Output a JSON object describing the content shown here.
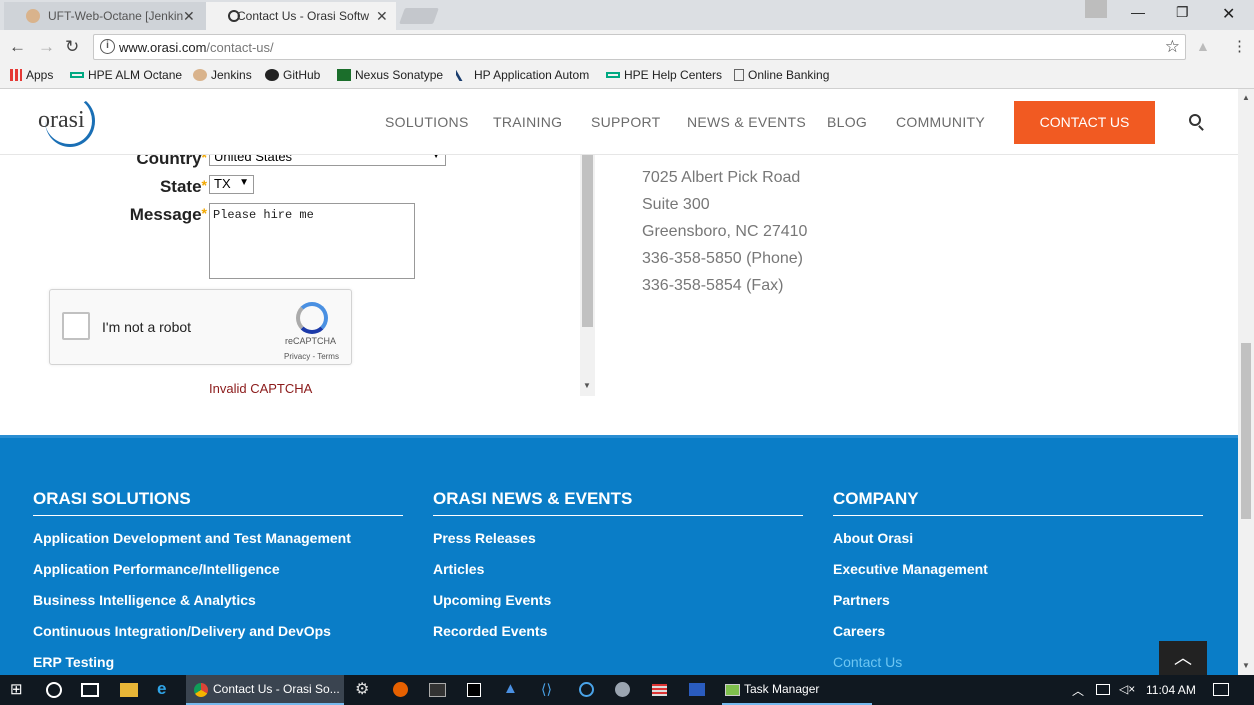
{
  "browser": {
    "tabs": [
      {
        "title": "UFT-Web-Octane [Jenkin",
        "active": false
      },
      {
        "title": "Contact Us - Orasi Softw",
        "active": true
      }
    ],
    "url_host": "www.orasi.com",
    "url_path": "/contact-us/",
    "bookmarks": [
      "Apps",
      "HPE ALM Octane",
      "Jenkins",
      "GitHub",
      "Nexus Sonatype",
      "HP Application Autom",
      "HPE Help Centers",
      "Online Banking"
    ]
  },
  "header": {
    "logo": "orasi",
    "nav": [
      "SOLUTIONS",
      "TRAINING",
      "SUPPORT",
      "NEWS & EVENTS",
      "BLOG",
      "COMMUNITY"
    ],
    "cta": "CONTACT US"
  },
  "form": {
    "country_label": "Country",
    "country_value": "United States",
    "state_label": "State",
    "state_value": "TX",
    "message_label": "Message",
    "message_value": "Please hire me",
    "required_mark": "*",
    "captcha_label": "I'm not a robot",
    "captcha_brand": "reCAPTCHA",
    "captcha_terms": "Privacy - Terms",
    "captcha_error": "Invalid CAPTCHA"
  },
  "address": [
    "7025 Albert Pick Road",
    "Suite 300",
    "Greensboro, NC 27410",
    "336-358-5850 (Phone)",
    "336-358-5854 (Fax)"
  ],
  "footer": {
    "solutions": {
      "title": "ORASI SOLUTIONS",
      "links": [
        "Application Development and Test Management",
        "Application Performance/Intelligence",
        "Business Intelligence & Analytics",
        "Continuous Integration/Delivery and DevOps",
        "ERP Testing"
      ]
    },
    "news": {
      "title": "ORASI NEWS & EVENTS",
      "links": [
        "Press Releases",
        "Articles",
        "Upcoming Events",
        "Recorded Events"
      ]
    },
    "company": {
      "title": "COMPANY",
      "links": [
        "About Orasi",
        "Executive Management",
        "Partners",
        "Careers",
        "Contact Us"
      ]
    }
  },
  "taskbar": {
    "chrome_label": "Contact Us - Orasi So...",
    "taskmgr_label": "Task Manager",
    "clock": "11:04 AM"
  },
  "colors": {
    "accent": "#f15a22",
    "footer": "#0a7dc7",
    "brand_blue": "#1a6fb5"
  }
}
